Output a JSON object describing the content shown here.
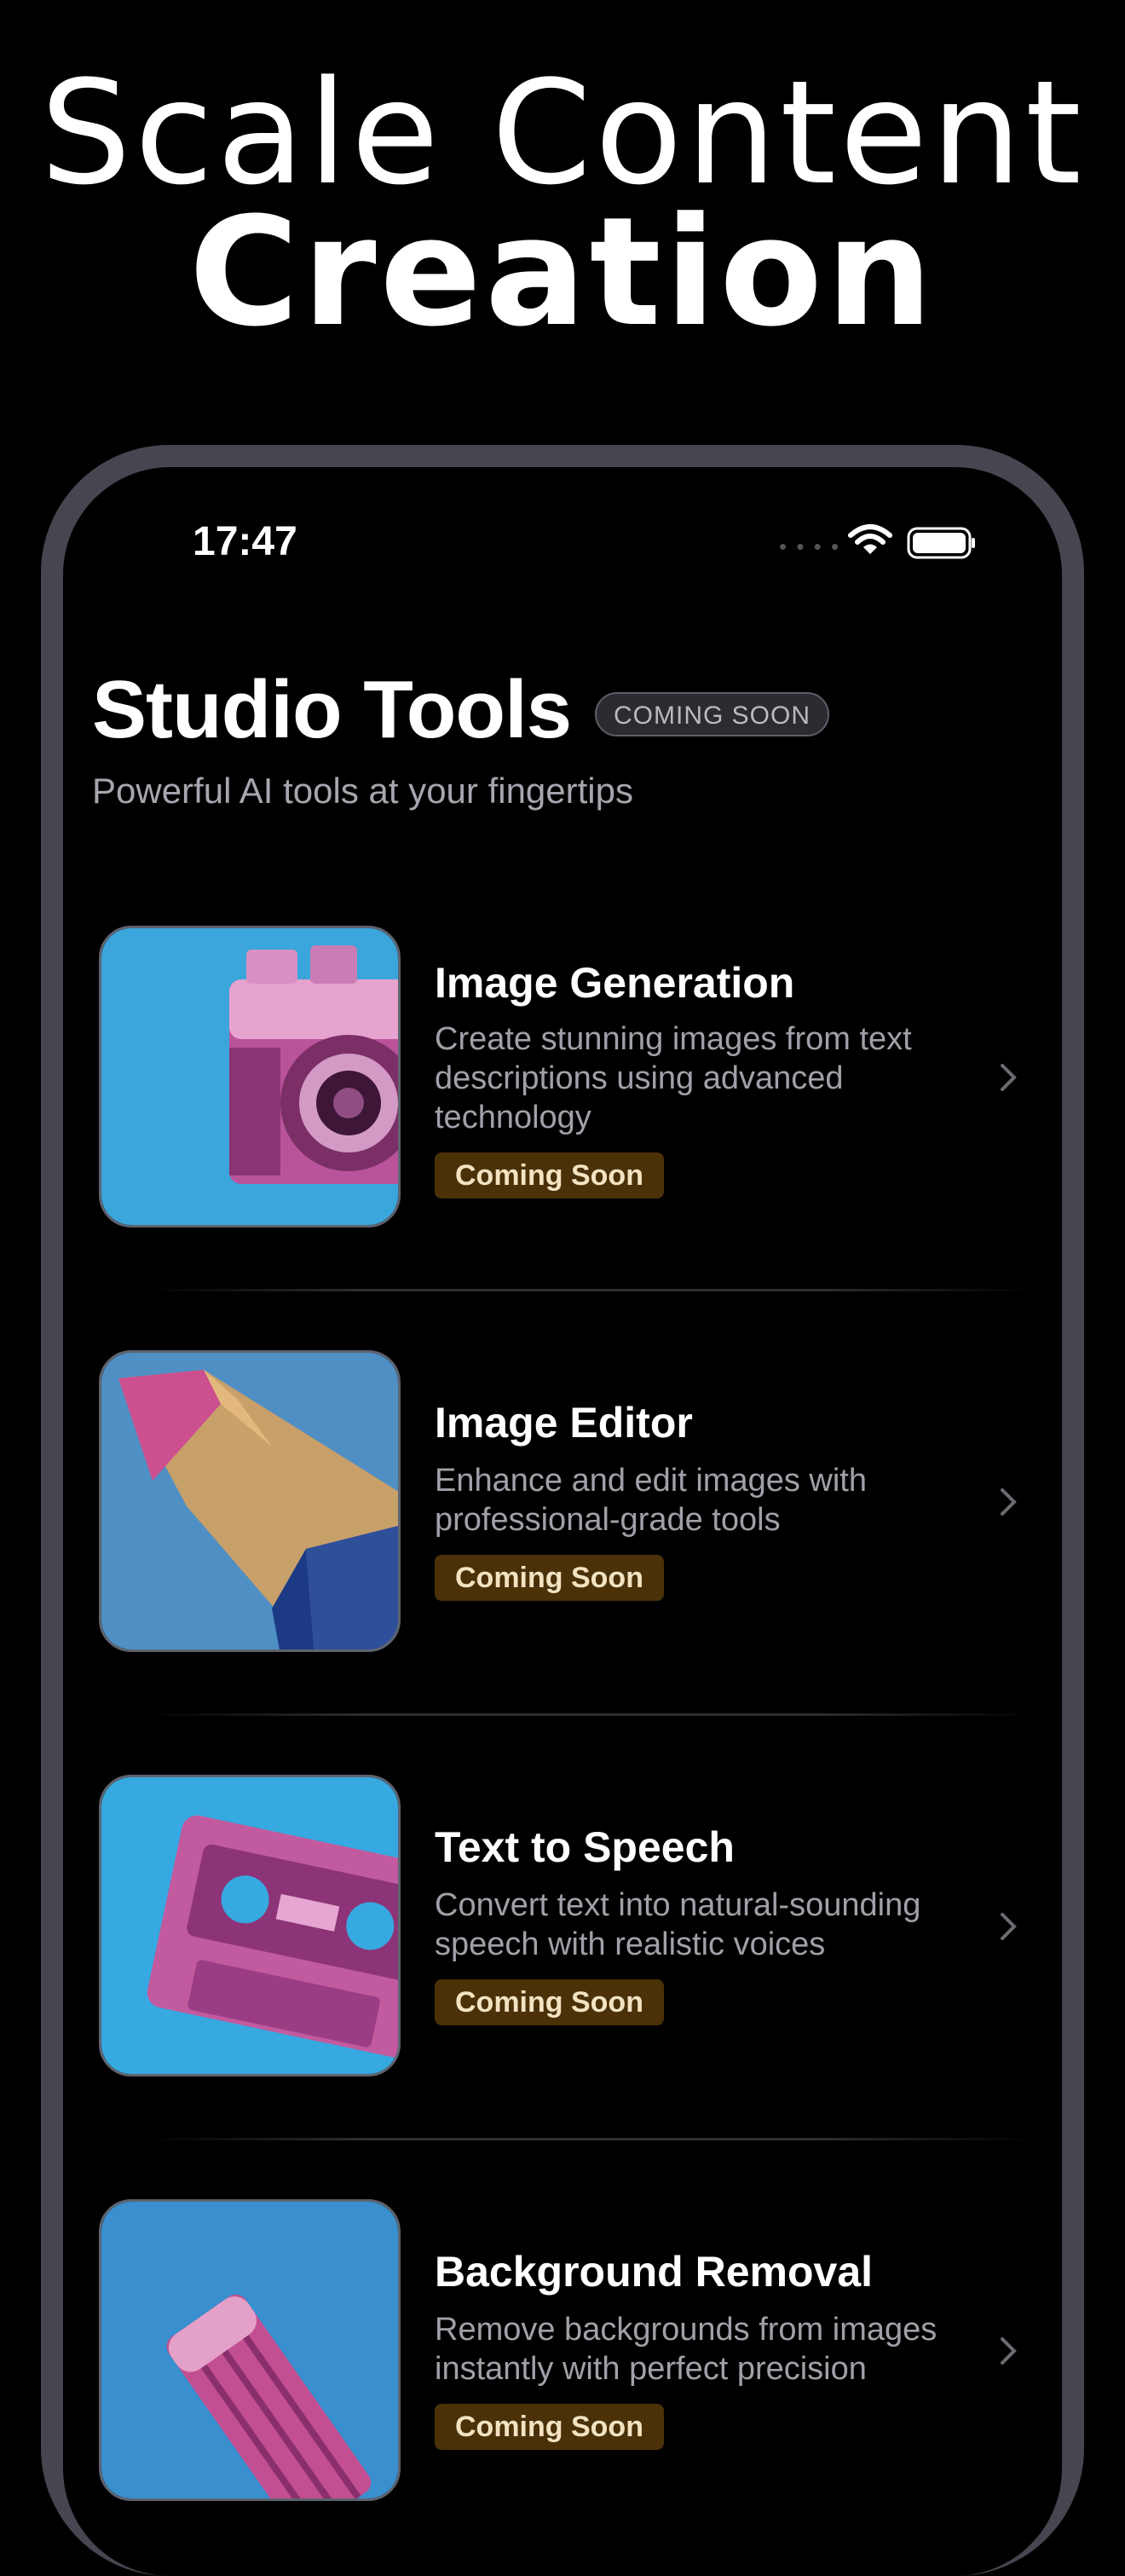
{
  "headline": {
    "line1": "Scale Content",
    "line2": "Creation"
  },
  "status_bar": {
    "time": "17:47"
  },
  "header": {
    "title": "Studio Tools",
    "pill": "COMING SOON",
    "subtitle": "Powerful AI tools at your fingertips"
  },
  "tools": [
    {
      "title": "Image Generation",
      "desc": "Create stunning images from text descriptions using advanced technology",
      "badge": "Coming Soon",
      "icon": "camera"
    },
    {
      "title": "Image Editor",
      "desc": "Enhance and edit images with professional-grade tools",
      "badge": "Coming Soon",
      "icon": "pencil"
    },
    {
      "title": "Text to Speech",
      "desc": "Convert text into natural-sounding speech with realistic voices",
      "badge": "Coming Soon",
      "icon": "cassette"
    },
    {
      "title": "Background Removal",
      "desc": "Remove backgrounds from images instantly with perfect precision",
      "badge": "Coming Soon",
      "icon": "eraser"
    }
  ],
  "colors": {
    "accent_badge_bg": "#4a3108",
    "thumb_blue": "#39a7dc",
    "pink": "#d35aa5"
  }
}
